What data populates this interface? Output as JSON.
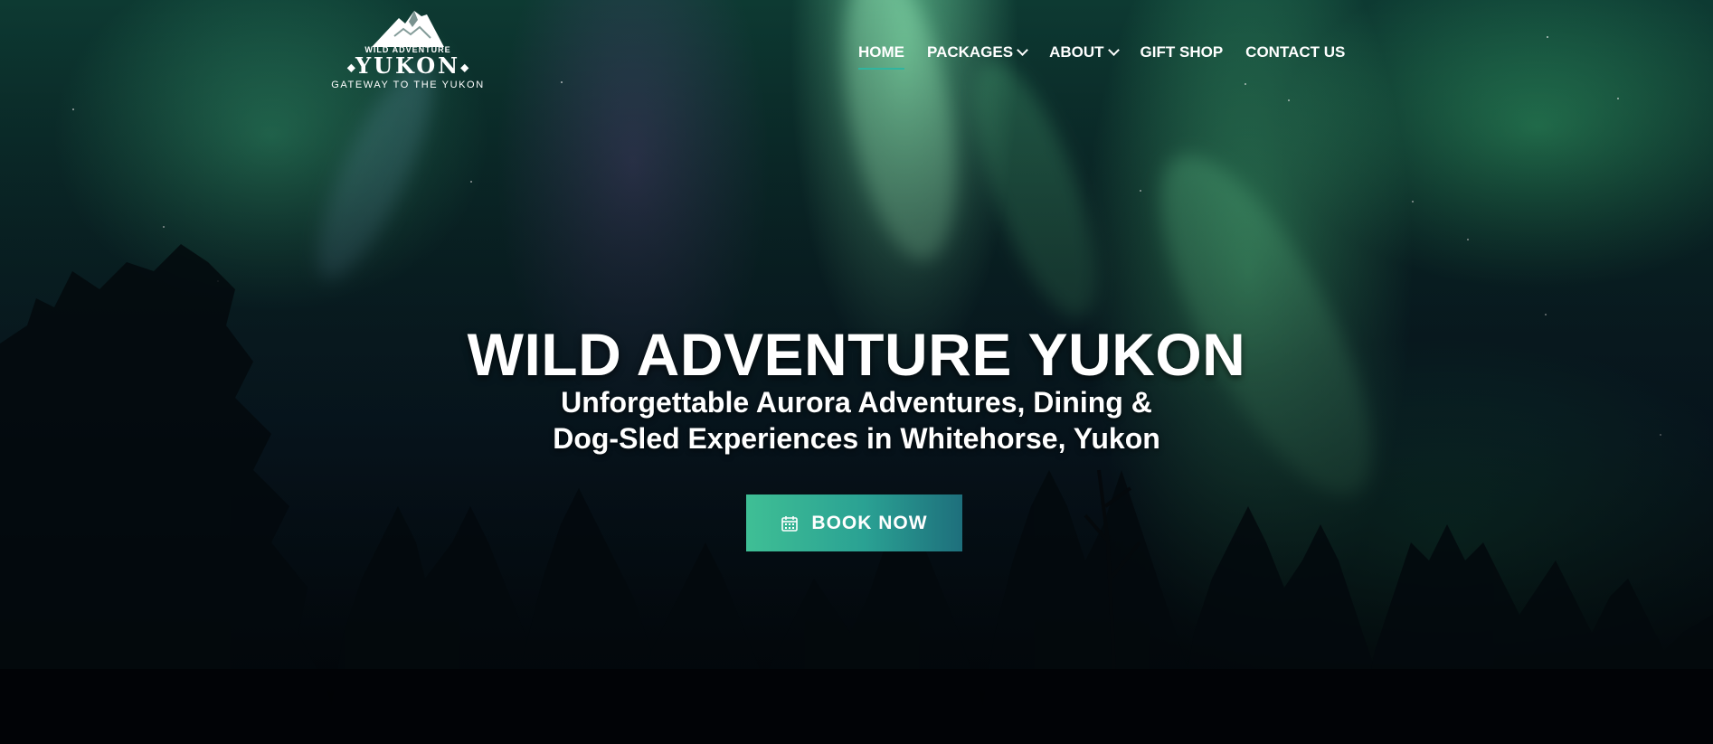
{
  "logo": {
    "top_line": "WILD ADVENTURE",
    "main": "YUKON",
    "tagline": "GATEWAY TO THE YUKON"
  },
  "nav": {
    "items": [
      {
        "label": "HOME",
        "active": true,
        "dropdown": false
      },
      {
        "label": "PACKAGES",
        "active": false,
        "dropdown": true
      },
      {
        "label": "ABOUT",
        "active": false,
        "dropdown": true
      },
      {
        "label": "GIFT SHOP",
        "active": false,
        "dropdown": false
      },
      {
        "label": "CONTACT US",
        "active": false,
        "dropdown": false
      }
    ]
  },
  "hero": {
    "title": "WILD ADVENTURE YUKON",
    "subtitle_line1": "Unforgettable Aurora Adventures, Dining &",
    "subtitle_line2": "Dog-Sled Experiences in Whitehorse, Yukon",
    "cta_label": "BOOK NOW",
    "cta_icon": "calendar-icon"
  },
  "colors": {
    "accent": "#2fb5a0",
    "button_gradient_start": "#3fbf95",
    "button_gradient_end": "#1e6f7c"
  }
}
